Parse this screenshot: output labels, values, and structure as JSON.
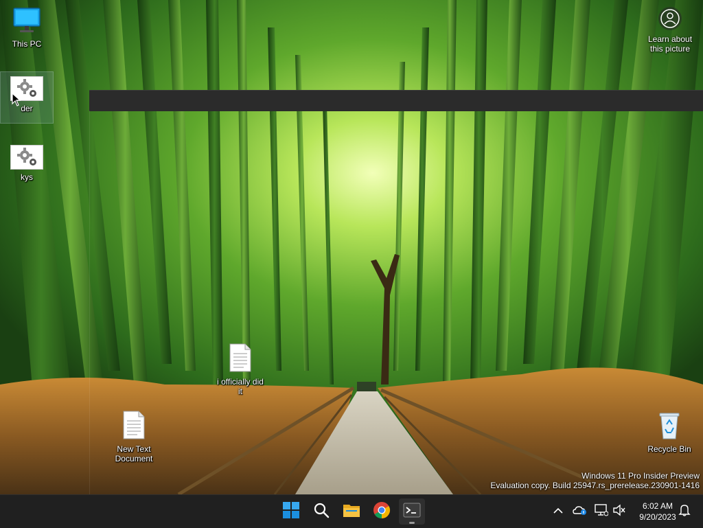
{
  "desktop": {
    "icons": [
      {
        "label": "This PC",
        "icon": "monitor-icon"
      },
      {
        "label": "der",
        "icon": "gear-icon"
      },
      {
        "label": "kys",
        "icon": "gear-icon"
      },
      {
        "label": "i officially did it",
        "icon": "text-file-icon"
      },
      {
        "label": "New Text Document",
        "icon": "text-file-icon"
      },
      {
        "label": "Recycle Bin",
        "icon": "recycle-bin-icon"
      }
    ],
    "learn_about": {
      "label": "Learn about this picture",
      "icon": "camera-icon"
    },
    "watermark": {
      "line1": "Windows 11 Pro Insider Preview",
      "line2": "Evaluation copy. Build 25947.rs_prerelease.230901-1416"
    }
  },
  "taskbar": {
    "buttons": [
      {
        "name": "start",
        "icon": "windows-logo-icon"
      },
      {
        "name": "search",
        "icon": "search-icon"
      },
      {
        "name": "file-explorer",
        "icon": "folder-icon"
      },
      {
        "name": "chrome",
        "icon": "chrome-icon"
      },
      {
        "name": "terminal",
        "icon": "terminal-icon",
        "active": true
      }
    ],
    "tray": {
      "icons": [
        "chevron-up-icon",
        "onedrive-icon",
        "network-icon",
        "volume-muted-icon"
      ],
      "time": "6:02 AM",
      "date": "9/20/2023",
      "notification_icon": "bell-icon"
    }
  },
  "colors": {
    "taskbar_bg": "#202020",
    "window_strip": "#2b2b2b",
    "windows_blue": "#0a84d6",
    "folder_yellow": "#f6c343"
  }
}
